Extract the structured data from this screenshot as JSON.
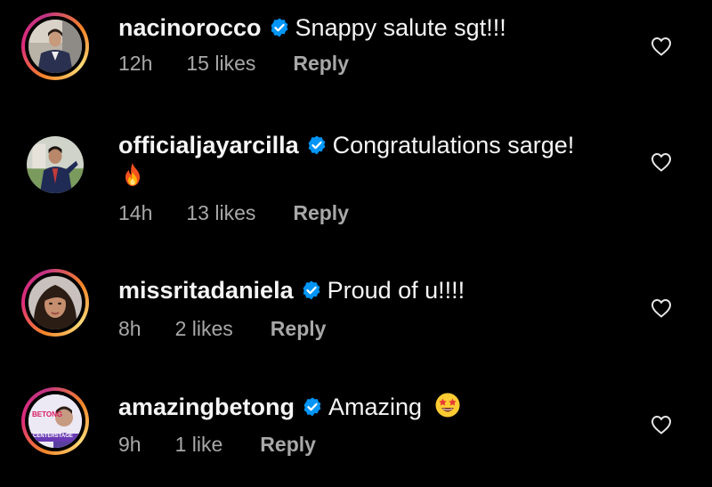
{
  "comments": [
    {
      "username": "nacinorocco",
      "text": "Snappy salute sgt!!!",
      "time": "12h",
      "likes": "15 likes",
      "reply": "Reply"
    },
    {
      "username": "officialjayarcilla",
      "text": "Congratulations sarge!",
      "extra_emoji": "fire",
      "time": "14h",
      "likes": "13 likes",
      "reply": "Reply"
    },
    {
      "username": "missritadaniela",
      "text": "Proud of u!!!!",
      "time": "8h",
      "likes": "2 likes",
      "reply": "Reply"
    },
    {
      "username": "amazingbetong",
      "text": "Amazing",
      "extra_emoji": "star-struck",
      "time": "9h",
      "likes": "1 like",
      "reply": "Reply",
      "avatar_text": {
        "line1": "BETONG",
        "line2": "CENTERSTAGE"
      }
    }
  ],
  "icons": {
    "verified": "verified-badge-icon",
    "like": "heart-outline-icon"
  },
  "colors": {
    "background": "#000000",
    "text": "#f5f5f5",
    "meta": "#a8a8a8",
    "verified": "#0095f6"
  }
}
